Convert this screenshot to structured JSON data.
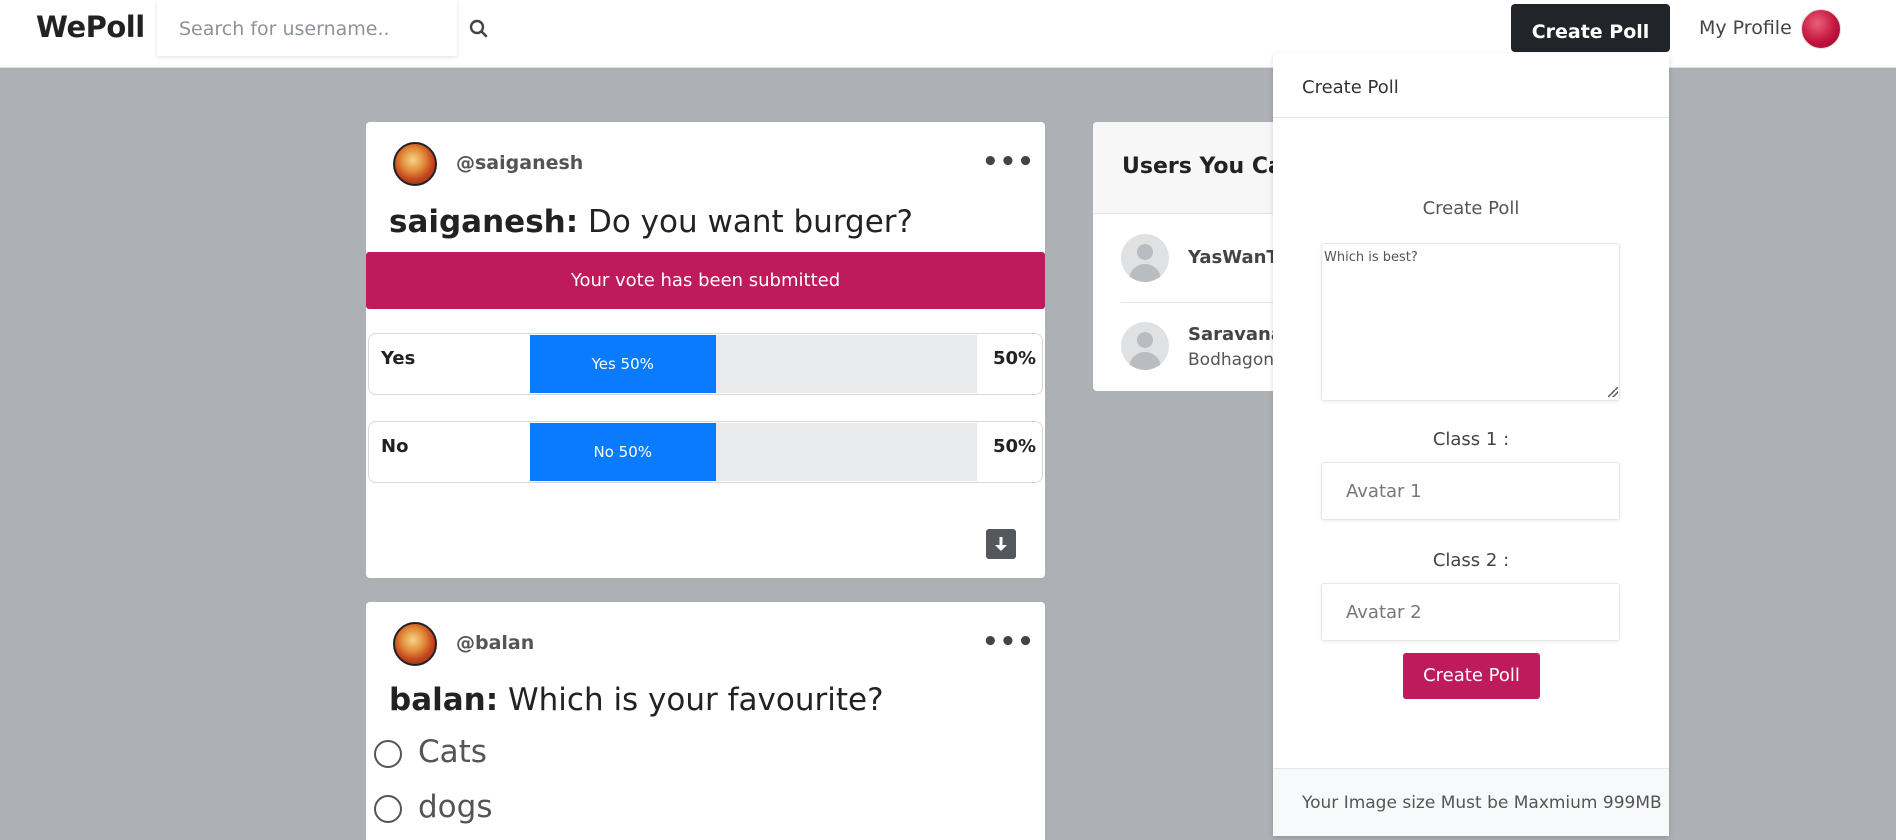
{
  "navbar": {
    "brand": "WePoll",
    "search_placeholder": "Search for username..",
    "create_poll_label": "Create Poll",
    "my_profile_label": "My Profile"
  },
  "feed": {
    "posts": [
      {
        "handle": "@saiganesh",
        "author": "saiganesh:",
        "question": "Do you want burger?",
        "banner": "Your vote has been submitted",
        "options": [
          {
            "label": "Yes",
            "bar_text": "Yes 50%",
            "percent": 50,
            "percent_text": "50%"
          },
          {
            "label": "No",
            "bar_text": "No 50%",
            "percent": 50,
            "percent_text": "50%"
          }
        ]
      },
      {
        "handle": "@balan",
        "author": "balan:",
        "question": "Which is your favourite?",
        "choices": [
          "Cats",
          "dogs"
        ]
      }
    ]
  },
  "suggestions": {
    "title": "Users You Can Follow",
    "users": [
      {
        "name": "YasWanTh",
        "sub": ""
      },
      {
        "name": "Saravanan",
        "sub": "Bodhagoni"
      }
    ]
  },
  "create_poll_dropdown": {
    "header": "Create Poll",
    "form_title": "Create Poll",
    "question_value": "Which is best?",
    "class1_label": "Class 1 :",
    "class1_placeholder": "Avatar 1",
    "class2_label": "Class 2 :",
    "class2_placeholder": "Avatar 2",
    "submit_label": "Create Poll",
    "footer_note": "Your Image size Must be Maxmium 999MB"
  },
  "colors": {
    "accent": "#bf1a5c",
    "bar": "#0a7bff",
    "background": "#adb0b4",
    "dark_button": "#212529"
  }
}
